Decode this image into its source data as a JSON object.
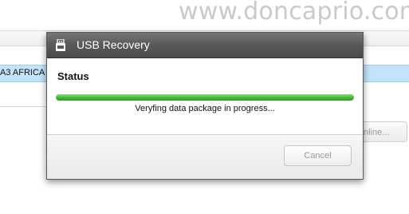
{
  "watermark": "www.doncaprio.com",
  "background_app": {
    "selected_row_text": "A3 AFRICA",
    "partial_button_label": "nline..."
  },
  "dialog": {
    "title": "USB Recovery",
    "title_icon": "usb-device-icon",
    "status_heading": "Status",
    "progress_message": "Veryfing data package in progress...",
    "progress_fraction": 1.0,
    "cancel_label": "Cancel",
    "cancel_enabled": false
  },
  "colors": {
    "titlebar": "#5b5b5b",
    "progress_green": "#48b93a",
    "selected_row": "#c2e3f8"
  }
}
